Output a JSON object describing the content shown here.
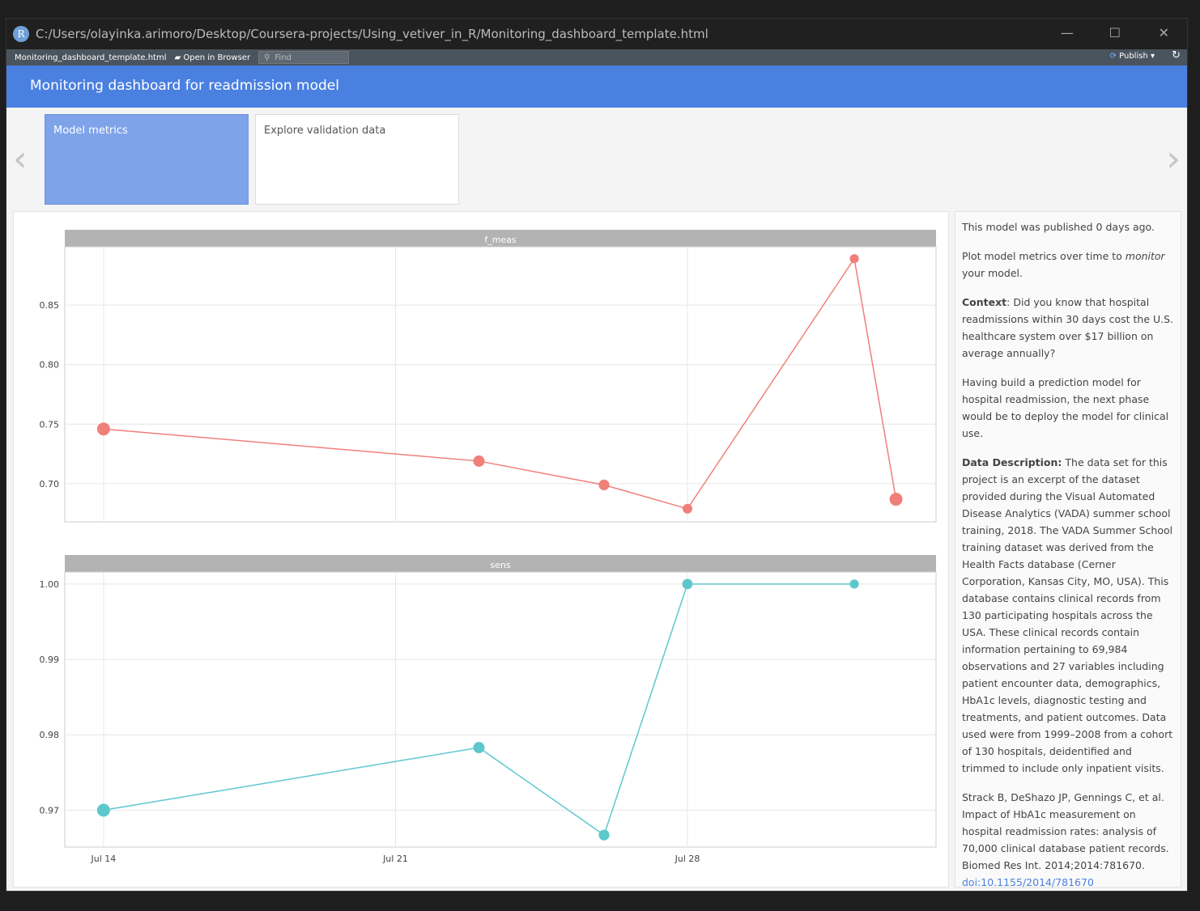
{
  "window": {
    "title": "C:/Users/olayinka.arimoro/Desktop/Coursera-projects/Using_vetiver_in_R/Monitoring_dashboard_template.html",
    "logo": "R"
  },
  "toolbar": {
    "file": "Monitoring_dashboard_template.html",
    "open_browser": "Open in Browser",
    "find_placeholder": "Find",
    "publish": "Publish"
  },
  "header": {
    "title": "Monitoring dashboard for readmission model"
  },
  "tabs": [
    {
      "label": "Model metrics",
      "active": true
    },
    {
      "label": "Explore validation data",
      "active": false
    }
  ],
  "chart_data": [
    {
      "type": "line",
      "title": "f_meas",
      "color": "#f07f7a",
      "x": [
        "Jul 14",
        "Jul 23",
        "Jul 26",
        "Jul 28",
        "Aug 1",
        "Aug 2"
      ],
      "x_days": [
        0,
        9,
        12,
        14,
        18,
        19
      ],
      "values": [
        0.746,
        0.719,
        0.699,
        0.679,
        0.889,
        0.687
      ],
      "sizes": [
        2,
        1.5,
        1.3,
        1,
        0.8,
        2
      ],
      "ylim": [
        0.668,
        0.899
      ],
      "yticks": [
        "0.70",
        "0.75",
        "0.80",
        "0.85"
      ],
      "ytick_values": [
        0.7,
        0.75,
        0.8,
        0.85
      ]
    },
    {
      "type": "line",
      "title": "sens",
      "color": "#5cc8cc",
      "x": [
        "Jul 14",
        "Jul 23",
        "Jul 26",
        "Jul 28",
        "Aug 1"
      ],
      "x_days": [
        0,
        9,
        12,
        14,
        18
      ],
      "values": [
        0.97,
        0.9783,
        0.9667,
        1.0,
        1.0
      ],
      "sizes": [
        2,
        1.5,
        1.3,
        1.2,
        0.8
      ],
      "ylim": [
        0.9651,
        1.0016
      ],
      "yticks": [
        "0.97",
        "0.98",
        "0.99",
        "1.00"
      ],
      "ytick_values": [
        0.97,
        0.98,
        0.99,
        1.0
      ]
    }
  ],
  "xaxis": {
    "ticks": [
      "Jul 14",
      "Jul 21",
      "Jul 28"
    ],
    "tick_days": [
      0,
      7,
      14
    ],
    "range": [
      -0.93,
      19.96
    ]
  },
  "side": {
    "published": "This model was published 0 days ago.",
    "p1a": "Plot model metrics over time to ",
    "p1em": "monitor",
    "p1b": " your model.",
    "ctx_label": "Context",
    "ctx": ": Did you know that hospital readmissions within 30 days cost the U.S. healthcare system over $17 billion on average annually?",
    "p3": "Having build a prediction model for hospital readmission, the next phase would be to deploy the model for clinical use.",
    "dd_label": "Data Description:",
    "dd": " The data set for this project is an excerpt of the dataset provided during the Visual Automated Disease Analytics (VADA) summer school training, 2018. The VADA Summer School training dataset was derived from the Health Facts database (Cerner Corporation, Kansas City, MO, USA). This database contains clinical records from 130 participating hospitals across the USA. These clinical records contain information pertaining to 69,984 observations and 27 variables including patient encounter data, demographics, HbA1c levels, diagnostic testing and treatments, and patient outcomes. Data used were from 1999–2008 from a cohort of 130 hospitals, deidentified and trimmed to include only inpatient visits.",
    "ref": "Strack B, DeShazo JP, Gennings C, et al. Impact of HbA1c measurement on hospital readmission rates: analysis of 70,000 clinical database patient records. Biomed Res Int. 2014;2014:781670.",
    "doi": "doi:10.1155/2014/781670"
  }
}
